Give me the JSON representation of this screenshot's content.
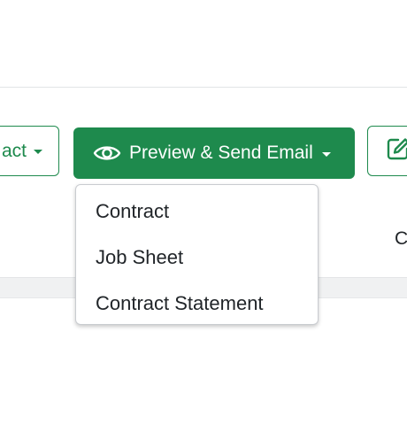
{
  "toolbar": {
    "left_button_label": "act",
    "preview_button_label": "Preview & Send Email",
    "right_button_icon": "edit-icon"
  },
  "preview_menu": {
    "items": [
      {
        "label": "Contract"
      },
      {
        "label": "Job Sheet"
      },
      {
        "label": "Contract Statement"
      }
    ]
  },
  "table": {
    "partial_header": "C"
  },
  "colors": {
    "brand_green": "#1e8a4d",
    "text": "#212529",
    "menu_border": "#c9ccd0"
  }
}
